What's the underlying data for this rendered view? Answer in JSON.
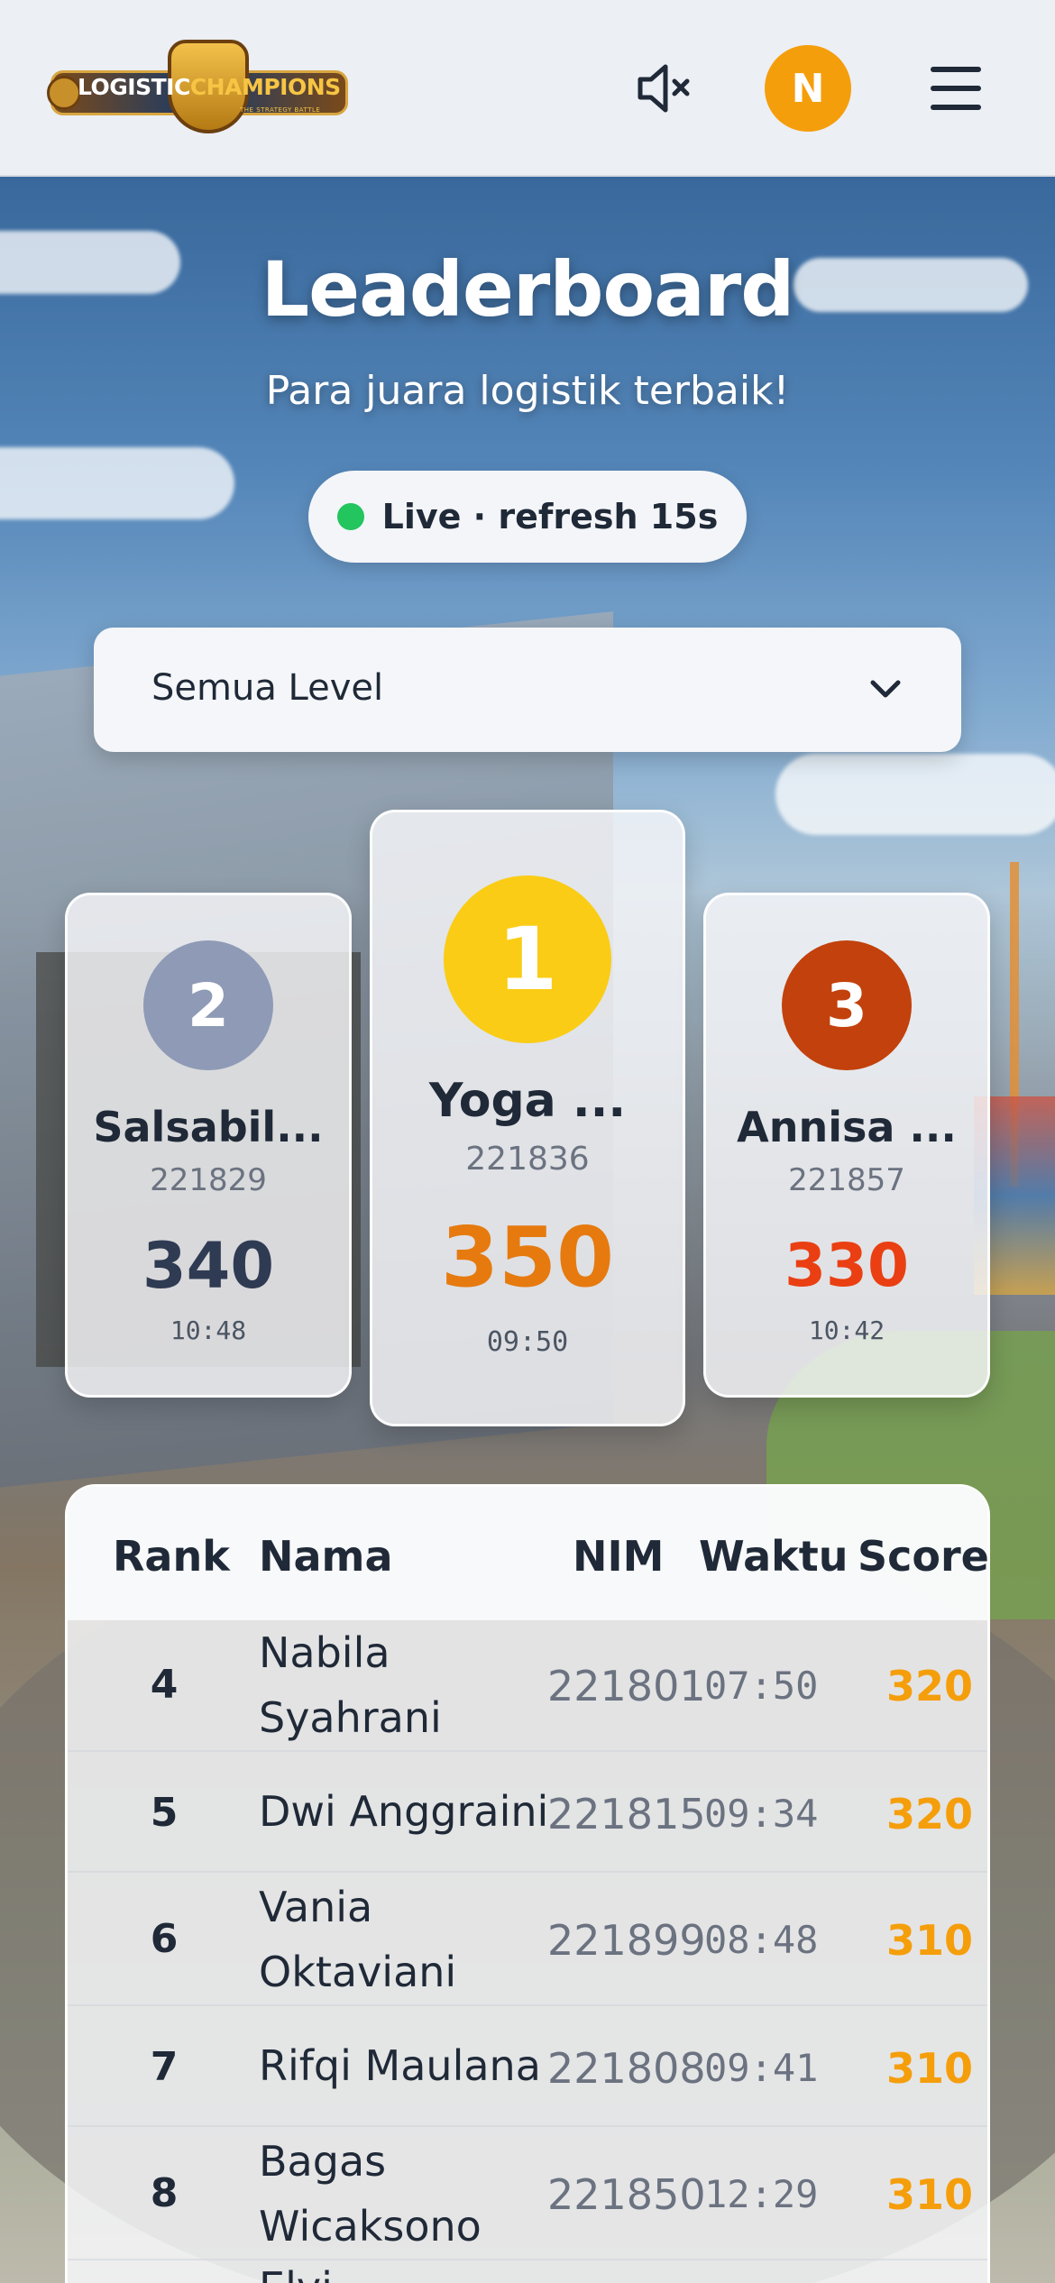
{
  "header": {
    "logo_text_a": "LOGISTIC",
    "logo_text_b": "CHAMPIONS",
    "logo_tagline": "THE STRATEGY BATTLE",
    "avatar_initial": "N"
  },
  "page": {
    "title": "Leaderboard",
    "subtitle": "Para juara logistik terbaik!",
    "live_label": "Live · refresh 15s",
    "live_color": "#22c55e"
  },
  "filter": {
    "selected": "Semua Level"
  },
  "podium": {
    "first": {
      "rank": "1",
      "name": "Yoga ...",
      "nim": "221836",
      "score": "350",
      "time": "09:50"
    },
    "second": {
      "rank": "2",
      "name": "Salsabil...",
      "nim": "221829",
      "score": "340",
      "time": "10:48"
    },
    "third": {
      "rank": "3",
      "name": "Annisa ...",
      "nim": "221857",
      "score": "330",
      "time": "10:42"
    }
  },
  "table": {
    "headers": {
      "rank": "Rank",
      "name": "Nama",
      "nim": "NIM",
      "time": "Waktu",
      "score": "Score"
    },
    "rows": [
      {
        "rank": "4",
        "name_line1": "Nabila",
        "name_line2": "Syahrani",
        "nim": "221801",
        "time": "07:50",
        "score": "320"
      },
      {
        "rank": "5",
        "name_line1": "Dwi Anggraini",
        "name_line2": "",
        "nim": "221815",
        "time": "09:34",
        "score": "320"
      },
      {
        "rank": "6",
        "name_line1": "Vania",
        "name_line2": "Oktaviani",
        "nim": "221899",
        "time": "08:48",
        "score": "310"
      },
      {
        "rank": "7",
        "name_line1": "Rifqi Maulana",
        "name_line2": "",
        "nim": "221808",
        "time": "09:41",
        "score": "310"
      },
      {
        "rank": "8",
        "name_line1": "Bagas",
        "name_line2": "Wicaksono",
        "nim": "221850",
        "time": "12:29",
        "score": "310"
      },
      {
        "rank": "",
        "name_line1": "Elvi...",
        "name_line2": "",
        "nim": "",
        "time": "",
        "score": ""
      }
    ]
  },
  "colors": {
    "gold": "#facc15",
    "silver": "#8e9ab6",
    "bronze": "#c2410c",
    "score_accent": "#f59e0b"
  }
}
